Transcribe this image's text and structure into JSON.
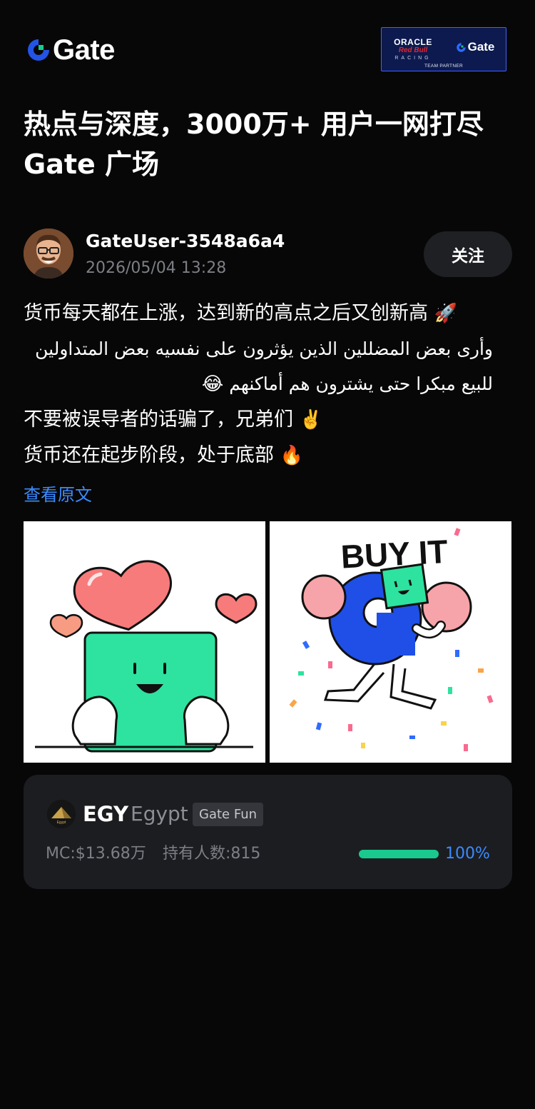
{
  "header": {
    "logo_text": "Gate",
    "partner": {
      "oracle": "ORACLE",
      "redbull": "Red Bull",
      "racing": "RACING",
      "gate": "Gate",
      "team_partner": "TEAM PARTNER"
    }
  },
  "headline": {
    "line1": "热点与深度，3000万+ 用户一网打尽",
    "line2": "Gate 广场"
  },
  "author": {
    "name": "GateUser-3548a6a4",
    "time": "2026/05/04 13:28",
    "follow_label": "关注"
  },
  "post": {
    "line1": "货币每天都在上涨，达到新的高点之后又创新高",
    "line1_emoji": "🚀",
    "line2": "وأرى بعض المضللين الذين يؤثرون على نفسيه بعض المتداولين",
    "line3": "للبيع مبكرا حتى يشترون هم أماكنهم",
    "line3_emoji": "😂",
    "line4": "不要被误导者的话骗了，兄弟们",
    "line4_emoji": "✌️",
    "line5": "货币还在起步阶段，处于底部",
    "line5_emoji": "🔥",
    "translate_label": "查看原文"
  },
  "images": {
    "right_caption": "BUY IT"
  },
  "token": {
    "symbol": "EGY",
    "name": "Egypt",
    "tag": "Gate Fun",
    "logo_text": "Egypt",
    "market_cap": "MC:$13.68万",
    "holders": "持有人数:815",
    "progress_percent": 100,
    "progress_label": "100%"
  },
  "colors": {
    "background": "#070707",
    "accent_blue": "#3b8bff",
    "progress_green": "#1ac98e",
    "mascot_green": "#2ee2a0",
    "card": "#1c1d21"
  }
}
